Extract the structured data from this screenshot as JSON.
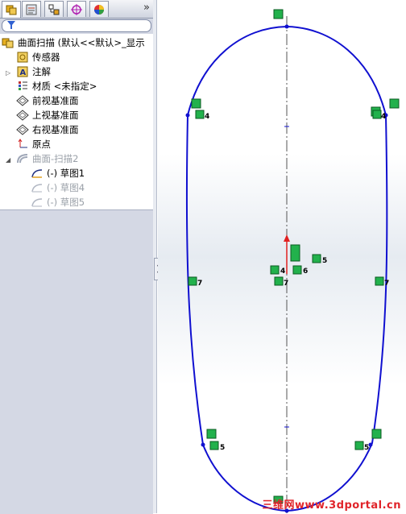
{
  "tabs": [
    {
      "name": "FeatureManager",
      "icon": "feature-manager-icon"
    },
    {
      "name": "PropertyManager",
      "icon": "property-manager-icon"
    },
    {
      "name": "ConfigurationManager",
      "icon": "configuration-manager-icon"
    },
    {
      "name": "DimXpert",
      "icon": "dimxpert-icon"
    },
    {
      "name": "Display",
      "icon": "display-manager-icon"
    }
  ],
  "tree": {
    "root": "曲面扫描  (默认<<默认>_显示",
    "items": [
      {
        "label": "传感器",
        "icon": "sensors-icon",
        "dim": false
      },
      {
        "label": "注解",
        "icon": "annotations-icon",
        "dim": false
      },
      {
        "label": "材质 <未指定>",
        "icon": "material-icon",
        "dim": false
      },
      {
        "label": "前视基准面",
        "icon": "plane-icon",
        "dim": false
      },
      {
        "label": "上视基准面",
        "icon": "plane-icon",
        "dim": false
      },
      {
        "label": "右视基准面",
        "icon": "plane-icon",
        "dim": false
      },
      {
        "label": "原点",
        "icon": "origin-icon",
        "dim": false
      },
      {
        "label": "曲面-扫描2",
        "icon": "sweep-surface-icon",
        "dim": true
      }
    ],
    "children": [
      {
        "label": "(-) 草图1",
        "dim": false
      },
      {
        "label": "(-) 草图4",
        "dim": true
      },
      {
        "label": "(-) 草图5",
        "dim": true
      }
    ]
  },
  "relations": {
    "top": "",
    "upper_left": "4",
    "upper_right": "4",
    "center_left": "4",
    "center_right": "6",
    "center_far": "5",
    "mid_left": "7",
    "mid_right": "7",
    "mid_center": "7",
    "lower_left": "5",
    "lower_right": "5"
  },
  "colors": {
    "sketch": "#1010d0",
    "relation": "#22b14c",
    "watermark": "#e0242a"
  },
  "watermark": "三维网www.3dportal.cn"
}
